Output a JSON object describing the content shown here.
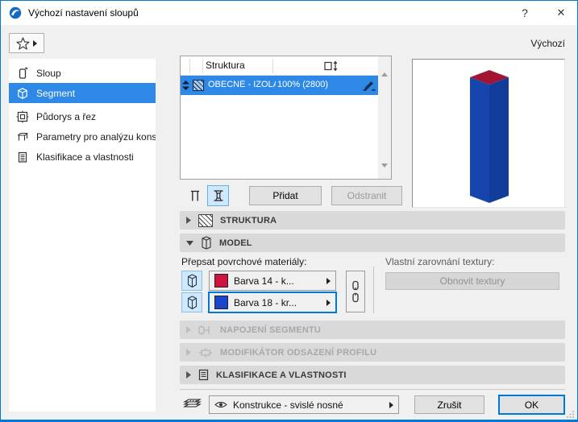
{
  "window": {
    "title": "Výchozí nastavení sloupů",
    "help": "?",
    "close": "✕",
    "default_label": "Výchozí"
  },
  "sidebar": {
    "items": [
      {
        "label": "Sloup",
        "icon": "column-icon"
      },
      {
        "label": "Segment",
        "icon": "cube-icon",
        "selected": true
      },
      {
        "label": "Půdorys a řez",
        "icon": "plan-section-icon"
      },
      {
        "label": "Parametry pro analýzu konst...",
        "icon": "structural-analysis-icon"
      },
      {
        "label": "Klasifikace a vlastnosti",
        "icon": "document-icon"
      }
    ]
  },
  "table": {
    "header": "Struktura",
    "row": {
      "name": "OBECNÉ - IZOLAČNÍ M...",
      "height": "100% (2800)",
      "selected": true
    },
    "add": "Přidat",
    "remove": "Odstranit"
  },
  "sections": {
    "struktura": "STRUKTURA",
    "model": "MODEL",
    "napojeni": "NAPOJENÍ SEGMENTU",
    "modifikator": "MODIFIKÁTOR ODSAZENÍ PROFILU",
    "klasifikace": "KLASIFIKACE A VLASTNOSTI"
  },
  "model": {
    "override_label": "Přepsat povrchové materiály:",
    "material_top": {
      "label": "Barva 14 - k...",
      "color": "#d01240"
    },
    "material_bottom": {
      "label": "Barva 18 - kr...",
      "color": "#1a46cd"
    },
    "texture_label": "Vlastní zarovnání textury:",
    "reset_label": "Obnovit textury"
  },
  "footer": {
    "layer_value": "Konstrukce - svislé nosné",
    "cancel": "Zrušit",
    "ok": "OK"
  },
  "colors": {
    "accent": "#0079d8",
    "selection": "#2d89e5",
    "preview_blue": "#1545ad",
    "preview_red": "#a31332"
  }
}
